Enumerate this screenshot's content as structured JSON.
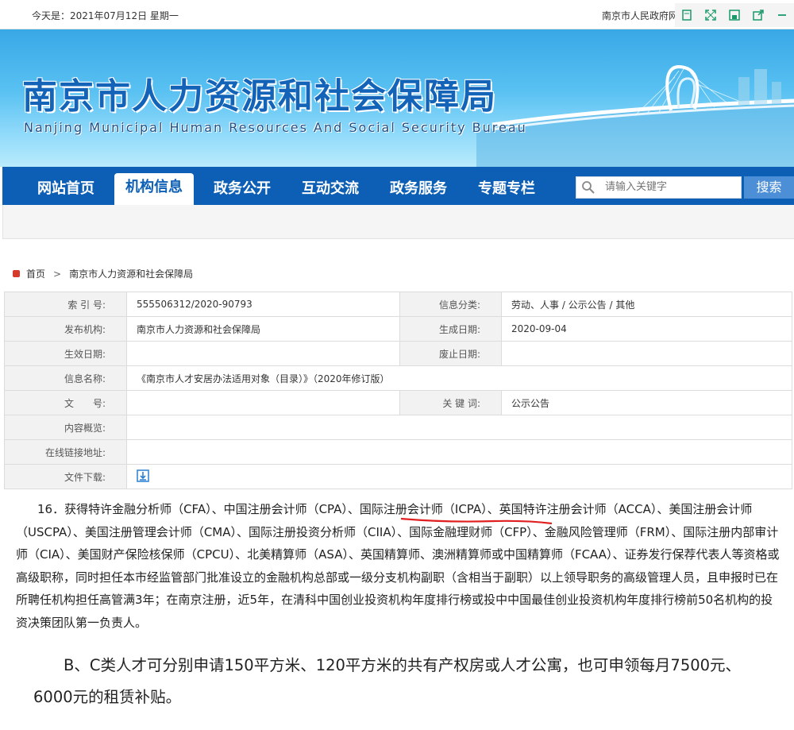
{
  "topbar": {
    "date": "今天是：2021年07月12日 星期一",
    "gov_link": "南京市人民政府网"
  },
  "tools": [
    "page-icon",
    "fullscreen-icon",
    "save-icon",
    "share-icon",
    "minimize-icon"
  ],
  "banner": {
    "title": "南京市人力资源和社会保障局",
    "subtitle": "Nanjing Municipal Human Resources And Social Security Bureau"
  },
  "nav": {
    "items": [
      {
        "label": "网站首页",
        "active": false
      },
      {
        "label": "机构信息",
        "active": true
      },
      {
        "label": "政务公开",
        "active": false
      },
      {
        "label": "互动交流",
        "active": false
      },
      {
        "label": "政务服务",
        "active": false
      },
      {
        "label": "专题专栏",
        "active": false
      }
    ],
    "search_placeholder": "请输入关键字",
    "search_button": "搜索"
  },
  "breadcrumb": {
    "home": "首页",
    "sep": ">",
    "current": "南京市人力资源和社会保障局"
  },
  "info": {
    "index_label": "索 引 号:",
    "index_value": "555506312/2020-90793",
    "category_label": "信息分类:",
    "category_value": "劳动、人事 / 公示公告 / 其他",
    "publisher_label": "发布机构:",
    "publisher_value": "南京市人力资源和社会保障局",
    "created_label": "生成日期:",
    "created_value": "2020-09-04",
    "effective_label": "生效日期:",
    "effective_value": "",
    "abolish_label": "废止日期:",
    "abolish_value": "",
    "name_label": "信息名称:",
    "name_value": "《南京市人才安居办法适用对象（目录）》（2020年修订版）",
    "docno_label": "文　　号:",
    "docno_value": "",
    "keywords_label": "关 键 词:",
    "keywords_value": "公示公告",
    "overview_label": "内容概览:",
    "overview_value": "",
    "link_label": "在线链接地址:",
    "link_value": "",
    "download_label": "文件下载:"
  },
  "content": {
    "paragraph_16": "16．获得特许金融分析师（CFA）、中国注册会计师（CPA）、国际注册会计师（ICPA）、英国特许注册会计师（ACCA）、美国注册会计师（USCPA）、美国注册管理会计师（CMA）、国际注册投资分析师（CIIA）、国际金融理财师（CFP）、金融风险管理师（FRM）、国际注册内部审计师（CIA）、美国财产保险核保师（CPCU）、北美精算师（ASA）、英国精算师、澳洲精算师或中国精算师（FCAA）、证券发行保荐代表人等资格或高级职称，同时担任本市经监管部门批准设立的金融机构总部或一级分支机构副职（含相当于副职）以上领导职务的高级管理人员，且申报时已在所聘任机构担任高管满3年；在南京注册，近5年，在清科中国创业投资机构年度排行榜或投中中国最佳创业投资机构年度排行榜前50名机构的投资决策团队第一负责人。",
    "paragraph_bc": "B、C类人才可分别申请150平方米、120平方米的共有产权房或人才公寓，也可申领每月7500元、6000元的租赁补贴。"
  },
  "colors": {
    "nav_bg": "#0d5fb5",
    "title_blue": "#1363b8",
    "annotation_red": "#e02020"
  }
}
